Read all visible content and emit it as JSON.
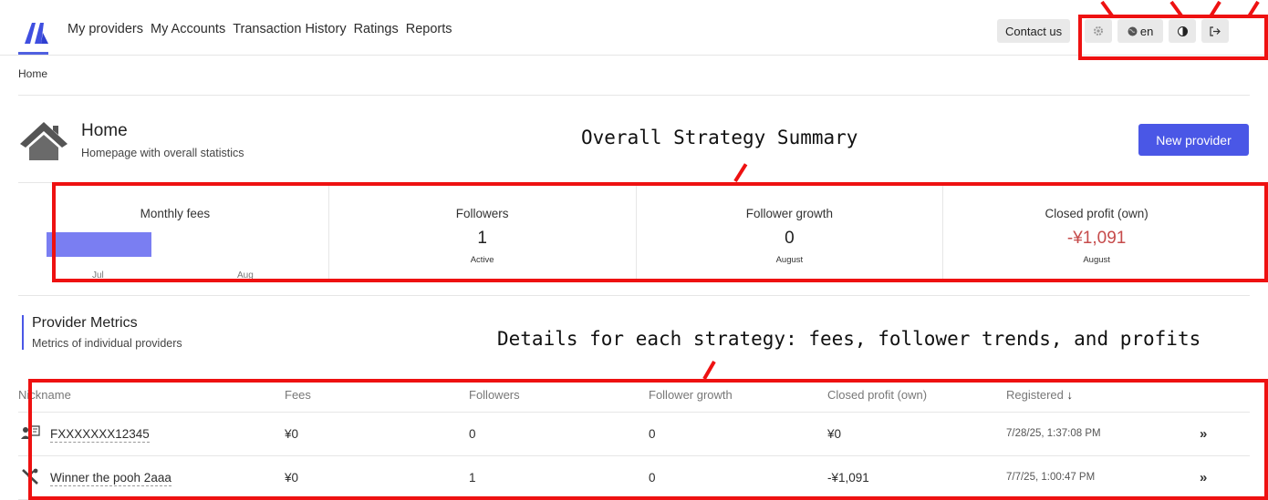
{
  "nav": {
    "items": [
      "My providers",
      "My Accounts",
      "Transaction History",
      "Ratings",
      "Reports"
    ],
    "contact_label": "Contact us",
    "lang_label": "en"
  },
  "breadcrumb": "Home",
  "header": {
    "title": "Home",
    "subtitle": "Homepage with overall statistics",
    "new_provider_label": "New provider"
  },
  "annotations": {
    "summary": "Overall Strategy Summary",
    "details": "Details for each strategy: fees, follower trends, and profits"
  },
  "stats": {
    "monthly_fees": {
      "label": "Monthly fees",
      "ticks": [
        "Jul",
        "Aug"
      ]
    },
    "followers": {
      "label": "Followers",
      "value": "1",
      "caption": "Active"
    },
    "growth": {
      "label": "Follower growth",
      "value": "0",
      "caption": "August"
    },
    "profit": {
      "label": "Closed profit (own)",
      "value": "-¥1,091",
      "caption": "August"
    }
  },
  "metrics": {
    "title": "Provider Metrics",
    "subtitle": "Metrics of individual providers",
    "columns": [
      "Nickname",
      "Fees",
      "Followers",
      "Follower growth",
      "Closed profit (own)",
      "Registered"
    ],
    "rows": [
      {
        "nickname": "FXXXXXXX12345",
        "fees": "¥0",
        "followers": "0",
        "growth": "0",
        "profit": "¥0",
        "registered": "7/28/25, 1:37:08 PM"
      },
      {
        "nickname": "Winner the pooh 2aaa",
        "fees": "¥0",
        "followers": "1",
        "growth": "0",
        "profit": "-¥1,091",
        "registered": "7/7/25, 1:00:47 PM"
      }
    ]
  },
  "colors": {
    "accent": "#4a57e6",
    "bar": "#7a7ef2",
    "negative": "#c64b4b",
    "highlight": "#ee1111"
  }
}
